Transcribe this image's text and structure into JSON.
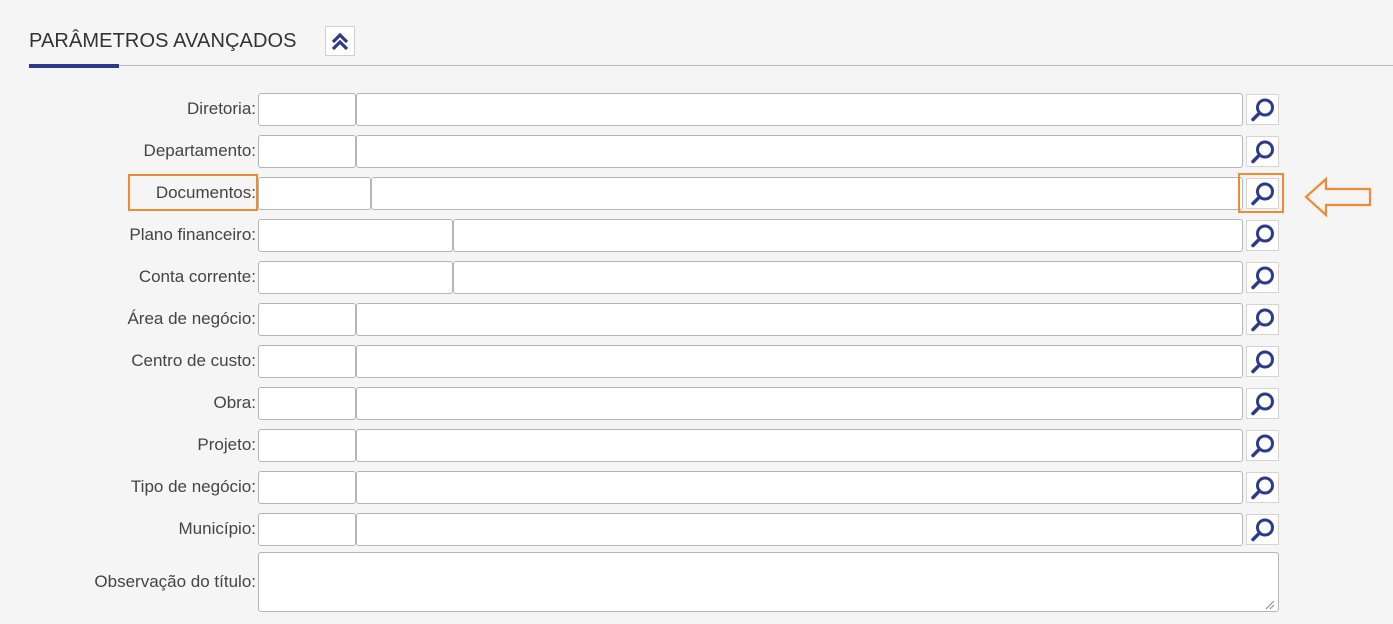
{
  "section": {
    "title": "PARÂMETROS AVANÇADOS",
    "collapse_icon": "double-chevron-up-icon",
    "accent_color": "#2b3a8c"
  },
  "fields": [
    {
      "id": "diretoria",
      "label": "Diretoria:",
      "code_value": "",
      "desc_value": ""
    },
    {
      "id": "departamento",
      "label": "Departamento:",
      "code_value": "",
      "desc_value": ""
    },
    {
      "id": "documentos",
      "label": "Documentos:",
      "code_value": "",
      "desc_value": ""
    },
    {
      "id": "plano-financeiro",
      "label": "Plano financeiro:",
      "code_value": "",
      "desc_value": ""
    },
    {
      "id": "conta-corrente",
      "label": "Conta corrente:",
      "code_value": "",
      "desc_value": ""
    },
    {
      "id": "area-de-negocio",
      "label": "Área de negócio:",
      "code_value": "",
      "desc_value": ""
    },
    {
      "id": "centro-de-custo",
      "label": "Centro de custo:",
      "code_value": "",
      "desc_value": ""
    },
    {
      "id": "obra",
      "label": "Obra:",
      "code_value": "",
      "desc_value": ""
    },
    {
      "id": "projeto",
      "label": "Projeto:",
      "code_value": "",
      "desc_value": ""
    },
    {
      "id": "tipo-de-negocio",
      "label": "Tipo de negócio:",
      "code_value": "",
      "desc_value": ""
    },
    {
      "id": "municipio",
      "label": "Município:",
      "code_value": "",
      "desc_value": ""
    }
  ],
  "observacao": {
    "label": "Observação do título:",
    "value": ""
  },
  "search_icon": "search-icon",
  "annotation": {
    "highlight_color": "#f08a33",
    "arrow_icon": "arrow-left-outline-icon"
  }
}
